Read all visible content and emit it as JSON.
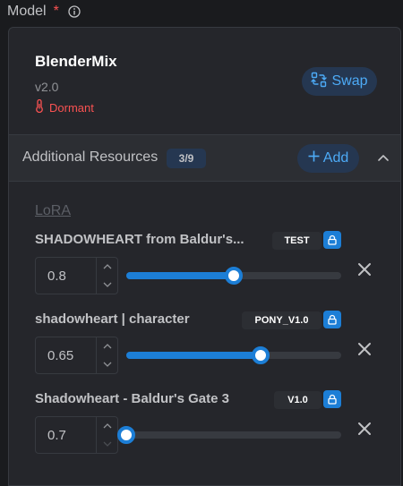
{
  "field": {
    "label": "Model",
    "required_mark": "*",
    "info_icon": "info-circle-icon"
  },
  "model": {
    "name": "BlenderMix",
    "version": "v2.0",
    "status": "Dormant",
    "status_icon": "thermometer-icon",
    "status_color": "#fa5252",
    "swap_label": "Swap",
    "swap_icon": "swap-arrows-icon"
  },
  "resources": {
    "title": "Additional Resources",
    "count": "3/9",
    "add_label": "Add",
    "add_icon": "plus-icon",
    "collapse_icon": "chevron-up-icon",
    "group_label": "LoRA",
    "items": [
      {
        "name": "SHADOWHEART from Baldur's...",
        "badge": "TEST",
        "strength": "0.8",
        "slider_value": 0.8,
        "slider_min": 0.7,
        "slider_max": 0.9
      },
      {
        "name": "shadowheart | character",
        "badge": "PONY_V1.0",
        "strength": "0.65",
        "slider_value": 0.65,
        "slider_min": 0.4,
        "slider_max": 0.8
      },
      {
        "name": "Shadowheart - Baldur's Gate 3",
        "badge": "V1.0",
        "strength": "0.7",
        "slider_value": 0.7,
        "slider_min": 0.7,
        "slider_max": 1.0
      }
    ]
  },
  "colors": {
    "accent": "#1c7ed6",
    "accent_text": "#4dabf7",
    "danger": "#fa5252",
    "background": "#1a1b1e",
    "card": "#25262b"
  }
}
